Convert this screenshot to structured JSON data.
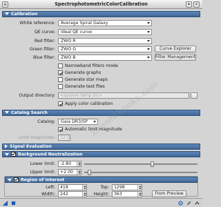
{
  "window": {
    "title": "SpectrophotometricColorCalibration"
  },
  "sections": {
    "calibration": "Calibration",
    "catalog_search": "Catalog Search",
    "signal_evaluation": "Signal Evaluation",
    "background_neutralization": "Background Neutralization",
    "region_of_interest": "Region of Interest"
  },
  "calibration": {
    "white_reference_label": "White reference:",
    "white_reference_value": "Average Spiral Galaxy",
    "qe_curve_label": "QE curve:",
    "qe_curve_value": "Ideal QE curve",
    "red_filter_label": "Red filter:",
    "red_filter_value": "ZWO R",
    "green_filter_label": "Green filter:",
    "green_filter_value": "ZWO G",
    "blue_filter_label": "Blue filter:",
    "blue_filter_value": "ZWO B",
    "curve_explorer_button": "Curve Explorer",
    "filter_management_button": "Filter Management",
    "narrowband_label": "Narrowband filters mode",
    "generate_graphs_label": "Generate graphs",
    "generate_star_maps_label": "Generate star maps",
    "generate_text_files_label": "Generate text files",
    "output_directory_label": "Output directory:",
    "output_directory_placeholder": "<system temp dir>",
    "apply_color_calibration_label": "Apply color calibration",
    "checks": {
      "narrowband": false,
      "generate_graphs": true,
      "generate_star_maps": false,
      "generate_text_files": false,
      "apply_color_calibration": true
    }
  },
  "catalog_search": {
    "catalog_label": "Catalog:",
    "catalog_value": "Gaia DR3/SP",
    "automatic_limit_label": "Automatic limit magnitude",
    "automatic_limit_checked": true,
    "limit_magnitude_label": "Limit magnitude:",
    "limit_magnitude_value": "12.0"
  },
  "background_neutralization": {
    "enabled": true,
    "lower_limit_label": "Lower limit:",
    "lower_limit_value": "-2.80",
    "upper_limit_label": "Upper limit:",
    "upper_limit_value": "+2.00",
    "lower_slider_fraction": 0.6,
    "upper_slider_fraction": 0.04
  },
  "region_of_interest": {
    "enabled": true,
    "left_label": "Left:",
    "left_value": "418",
    "top_label": "Top:",
    "top_value": "1298",
    "width_label": "Width:",
    "width_value": "242",
    "height_label": "Height:",
    "height_value": "363",
    "from_preview_button": "From Preview"
  },
  "watermark": "ZxenfBbooks.com",
  "colors": {
    "section_bar": "#4a73a6",
    "background": "#d4d4d4"
  }
}
